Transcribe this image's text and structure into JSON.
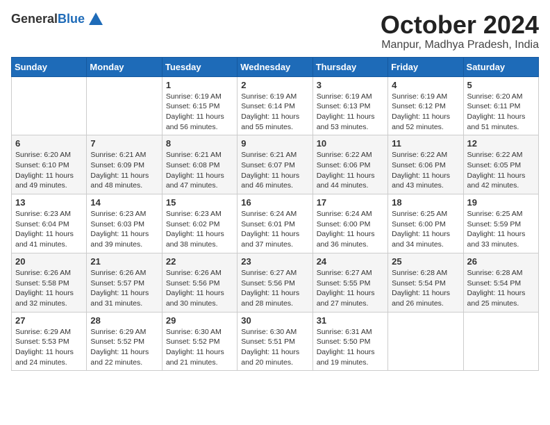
{
  "logo": {
    "general": "General",
    "blue": "Blue"
  },
  "title": "October 2024",
  "location": "Manpur, Madhya Pradesh, India",
  "weekdays": [
    "Sunday",
    "Monday",
    "Tuesday",
    "Wednesday",
    "Thursday",
    "Friday",
    "Saturday"
  ],
  "weeks": [
    [
      {
        "day": "",
        "sunrise": "",
        "sunset": "",
        "daylight": ""
      },
      {
        "day": "",
        "sunrise": "",
        "sunset": "",
        "daylight": ""
      },
      {
        "day": "1",
        "sunrise": "Sunrise: 6:19 AM",
        "sunset": "Sunset: 6:15 PM",
        "daylight": "Daylight: 11 hours and 56 minutes."
      },
      {
        "day": "2",
        "sunrise": "Sunrise: 6:19 AM",
        "sunset": "Sunset: 6:14 PM",
        "daylight": "Daylight: 11 hours and 55 minutes."
      },
      {
        "day": "3",
        "sunrise": "Sunrise: 6:19 AM",
        "sunset": "Sunset: 6:13 PM",
        "daylight": "Daylight: 11 hours and 53 minutes."
      },
      {
        "day": "4",
        "sunrise": "Sunrise: 6:19 AM",
        "sunset": "Sunset: 6:12 PM",
        "daylight": "Daylight: 11 hours and 52 minutes."
      },
      {
        "day": "5",
        "sunrise": "Sunrise: 6:20 AM",
        "sunset": "Sunset: 6:11 PM",
        "daylight": "Daylight: 11 hours and 51 minutes."
      }
    ],
    [
      {
        "day": "6",
        "sunrise": "Sunrise: 6:20 AM",
        "sunset": "Sunset: 6:10 PM",
        "daylight": "Daylight: 11 hours and 49 minutes."
      },
      {
        "day": "7",
        "sunrise": "Sunrise: 6:21 AM",
        "sunset": "Sunset: 6:09 PM",
        "daylight": "Daylight: 11 hours and 48 minutes."
      },
      {
        "day": "8",
        "sunrise": "Sunrise: 6:21 AM",
        "sunset": "Sunset: 6:08 PM",
        "daylight": "Daylight: 11 hours and 47 minutes."
      },
      {
        "day": "9",
        "sunrise": "Sunrise: 6:21 AM",
        "sunset": "Sunset: 6:07 PM",
        "daylight": "Daylight: 11 hours and 46 minutes."
      },
      {
        "day": "10",
        "sunrise": "Sunrise: 6:22 AM",
        "sunset": "Sunset: 6:06 PM",
        "daylight": "Daylight: 11 hours and 44 minutes."
      },
      {
        "day": "11",
        "sunrise": "Sunrise: 6:22 AM",
        "sunset": "Sunset: 6:06 PM",
        "daylight": "Daylight: 11 hours and 43 minutes."
      },
      {
        "day": "12",
        "sunrise": "Sunrise: 6:22 AM",
        "sunset": "Sunset: 6:05 PM",
        "daylight": "Daylight: 11 hours and 42 minutes."
      }
    ],
    [
      {
        "day": "13",
        "sunrise": "Sunrise: 6:23 AM",
        "sunset": "Sunset: 6:04 PM",
        "daylight": "Daylight: 11 hours and 41 minutes."
      },
      {
        "day": "14",
        "sunrise": "Sunrise: 6:23 AM",
        "sunset": "Sunset: 6:03 PM",
        "daylight": "Daylight: 11 hours and 39 minutes."
      },
      {
        "day": "15",
        "sunrise": "Sunrise: 6:23 AM",
        "sunset": "Sunset: 6:02 PM",
        "daylight": "Daylight: 11 hours and 38 minutes."
      },
      {
        "day": "16",
        "sunrise": "Sunrise: 6:24 AM",
        "sunset": "Sunset: 6:01 PM",
        "daylight": "Daylight: 11 hours and 37 minutes."
      },
      {
        "day": "17",
        "sunrise": "Sunrise: 6:24 AM",
        "sunset": "Sunset: 6:00 PM",
        "daylight": "Daylight: 11 hours and 36 minutes."
      },
      {
        "day": "18",
        "sunrise": "Sunrise: 6:25 AM",
        "sunset": "Sunset: 6:00 PM",
        "daylight": "Daylight: 11 hours and 34 minutes."
      },
      {
        "day": "19",
        "sunrise": "Sunrise: 6:25 AM",
        "sunset": "Sunset: 5:59 PM",
        "daylight": "Daylight: 11 hours and 33 minutes."
      }
    ],
    [
      {
        "day": "20",
        "sunrise": "Sunrise: 6:26 AM",
        "sunset": "Sunset: 5:58 PM",
        "daylight": "Daylight: 11 hours and 32 minutes."
      },
      {
        "day": "21",
        "sunrise": "Sunrise: 6:26 AM",
        "sunset": "Sunset: 5:57 PM",
        "daylight": "Daylight: 11 hours and 31 minutes."
      },
      {
        "day": "22",
        "sunrise": "Sunrise: 6:26 AM",
        "sunset": "Sunset: 5:56 PM",
        "daylight": "Daylight: 11 hours and 30 minutes."
      },
      {
        "day": "23",
        "sunrise": "Sunrise: 6:27 AM",
        "sunset": "Sunset: 5:56 PM",
        "daylight": "Daylight: 11 hours and 28 minutes."
      },
      {
        "day": "24",
        "sunrise": "Sunrise: 6:27 AM",
        "sunset": "Sunset: 5:55 PM",
        "daylight": "Daylight: 11 hours and 27 minutes."
      },
      {
        "day": "25",
        "sunrise": "Sunrise: 6:28 AM",
        "sunset": "Sunset: 5:54 PM",
        "daylight": "Daylight: 11 hours and 26 minutes."
      },
      {
        "day": "26",
        "sunrise": "Sunrise: 6:28 AM",
        "sunset": "Sunset: 5:54 PM",
        "daylight": "Daylight: 11 hours and 25 minutes."
      }
    ],
    [
      {
        "day": "27",
        "sunrise": "Sunrise: 6:29 AM",
        "sunset": "Sunset: 5:53 PM",
        "daylight": "Daylight: 11 hours and 24 minutes."
      },
      {
        "day": "28",
        "sunrise": "Sunrise: 6:29 AM",
        "sunset": "Sunset: 5:52 PM",
        "daylight": "Daylight: 11 hours and 22 minutes."
      },
      {
        "day": "29",
        "sunrise": "Sunrise: 6:30 AM",
        "sunset": "Sunset: 5:52 PM",
        "daylight": "Daylight: 11 hours and 21 minutes."
      },
      {
        "day": "30",
        "sunrise": "Sunrise: 6:30 AM",
        "sunset": "Sunset: 5:51 PM",
        "daylight": "Daylight: 11 hours and 20 minutes."
      },
      {
        "day": "31",
        "sunrise": "Sunrise: 6:31 AM",
        "sunset": "Sunset: 5:50 PM",
        "daylight": "Daylight: 11 hours and 19 minutes."
      },
      {
        "day": "",
        "sunrise": "",
        "sunset": "",
        "daylight": ""
      },
      {
        "day": "",
        "sunrise": "",
        "sunset": "",
        "daylight": ""
      }
    ]
  ]
}
